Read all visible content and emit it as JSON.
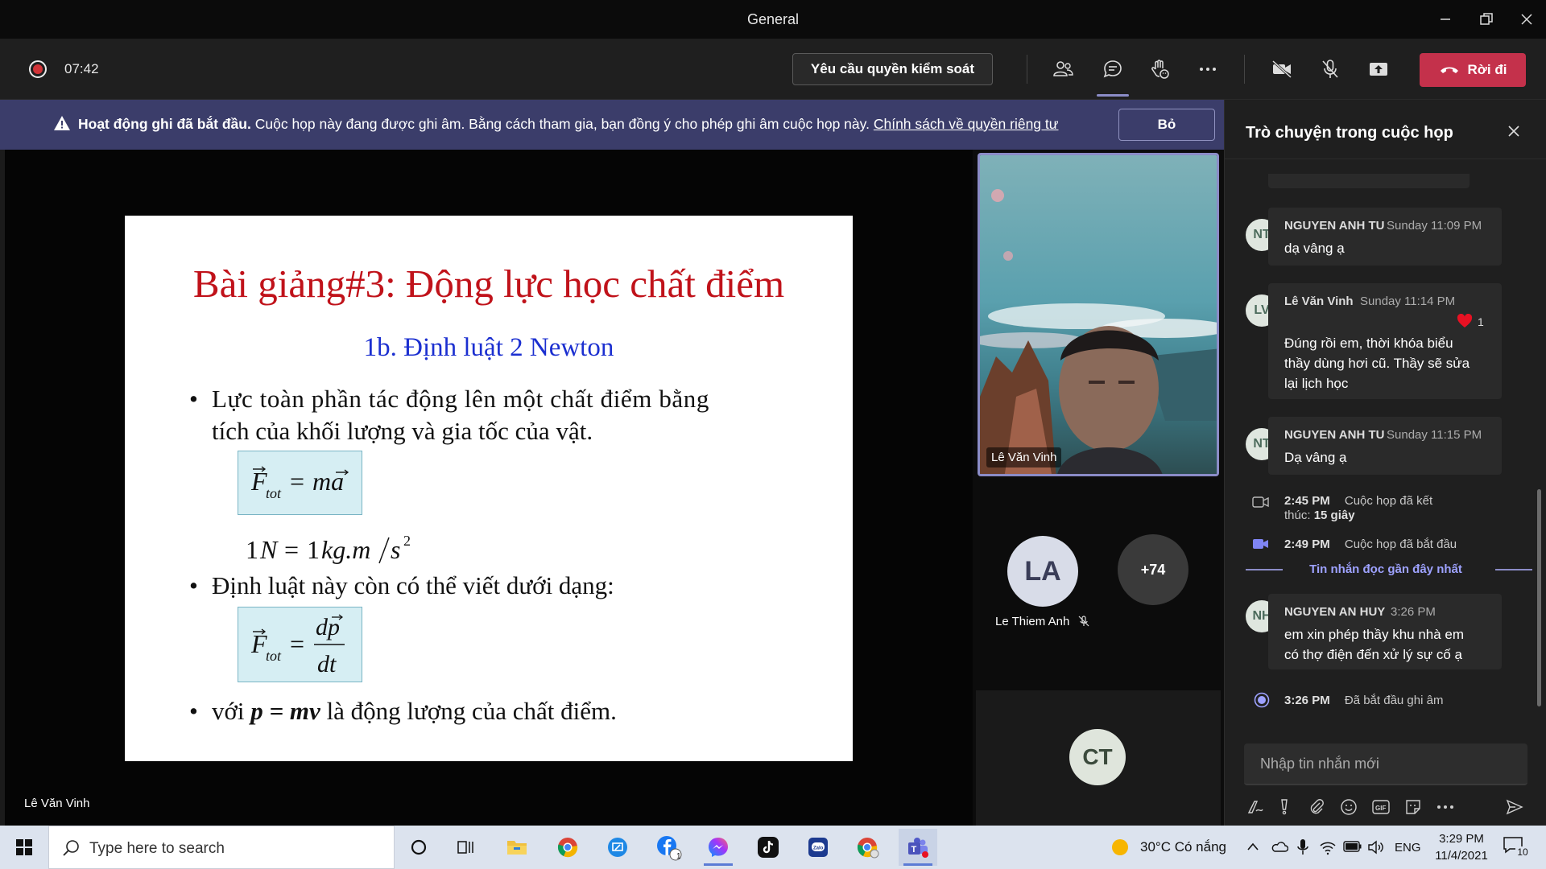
{
  "window": {
    "title": "General"
  },
  "toolbar": {
    "timer": "07:42",
    "request_control": "Yêu cầu quyền kiểm soát",
    "leave": "Rời đi"
  },
  "banner": {
    "bold": "Hoạt động ghi đã bắt đầu.",
    "text": "Cuộc họp này đang được ghi âm. Bằng cách tham gia, bạn đồng ý cho phép ghi âm cuộc họp này.",
    "link": "Chính sách về quyền riêng tư",
    "dismiss": "Bỏ"
  },
  "slide": {
    "title": "Bài giảng#3: Động lực học chất điểm",
    "subtitle": "1b. Định luật 2 Newton",
    "bullet1_line1": "Lực toàn phần tác động lên một chất điểm bằng",
    "bullet1_line2": "tích của khối lượng và gia tốc của vật.",
    "bullet2": "Định luật này còn có thể viết dưới dạng:",
    "bullet3_prefix": "với",
    "bullet3_formula": "p = mv",
    "bullet3_suffix": "là động lượng của chất điểm.",
    "bullet_glyph": "•"
  },
  "stage": {
    "presenter_name": "Lê Văn Vinh"
  },
  "participants": {
    "video_label": "Lê Văn Vinh",
    "la_initials": "LA",
    "la_name": "Le Thiem Anh",
    "more_count": "+74",
    "ct_initials": "CT"
  },
  "chat": {
    "title": "Trò chuyện trong cuộc họp",
    "messages": [
      {
        "initials": "NT",
        "sender": "NGUYEN ANH TU",
        "time": "Sunday 11:09 PM",
        "lines": [
          "dạ vâng ạ"
        ]
      },
      {
        "initials": "LV",
        "sender": "Lê Văn Vinh",
        "time": "Sunday 11:14 PM",
        "reaction_count": "1",
        "lines": [
          "Đúng rồi em, thời khóa biểu",
          "thầy dùng hơi cũ. Thầy sẽ sửa",
          "lại lịch học"
        ]
      },
      {
        "initials": "NT",
        "sender": "NGUYEN ANH TU",
        "time": "Sunday 11:15 PM",
        "lines": [
          "Dạ vâng ạ"
        ]
      },
      {
        "initials": "NH",
        "sender": "NGUYEN AN HUY",
        "time": "3:26 PM",
        "lines": [
          "em xin phép thầy khu nhà em",
          "có thợ điện đến xử lý sự cố ạ"
        ]
      }
    ],
    "system": [
      {
        "time": "2:45 PM",
        "text_line1": "Cuộc họp đã kết",
        "text_line2_prefix": "thúc:",
        "text_line2_bold": "15 giây"
      },
      {
        "time": "2:49 PM",
        "text": "Cuộc họp đã bắt đầu"
      },
      {
        "time": "3:26 PM",
        "text": "Đã bắt đầu ghi âm"
      }
    ],
    "divider": "Tin nhắn đọc gần đây nhất",
    "compose_placeholder": "Nhập tin nhắn mới"
  },
  "taskbar": {
    "search_placeholder": "Type here to search",
    "facebook_badge": "1",
    "weather": "30°C  Có nắng",
    "lang": "ENG",
    "time": "3:29 PM",
    "date": "11/4/2021",
    "notif_count": "10"
  },
  "colors": {
    "accent": "#8b8cc7",
    "leave": "#c4314b",
    "banner": "#3b3d6a",
    "slide_title": "#c0121a",
    "slide_sub": "#1b2fd0"
  }
}
